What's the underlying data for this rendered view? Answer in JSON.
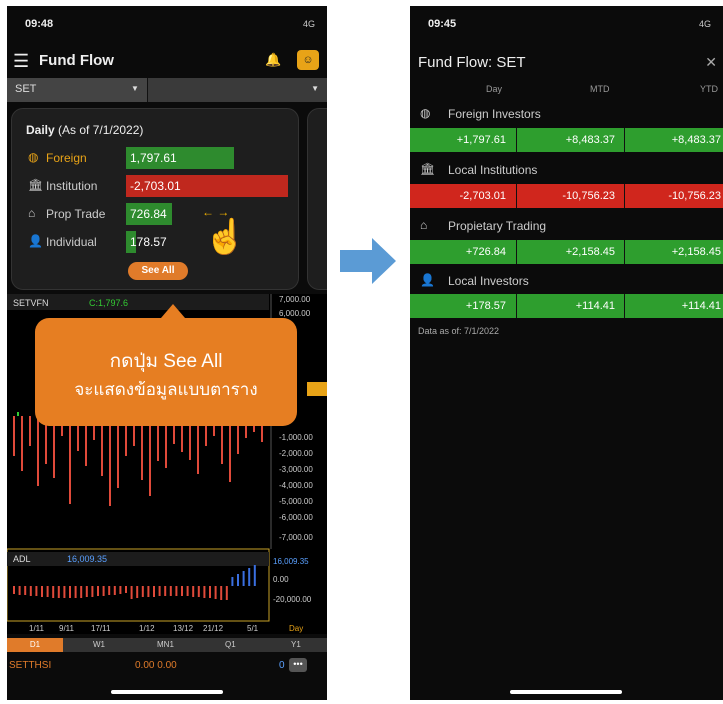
{
  "left": {
    "status": {
      "time": "09:48",
      "signal": "4G"
    },
    "header": {
      "title": "Fund Flow"
    },
    "selector": {
      "market": "SET"
    },
    "card": {
      "title_bold": "Daily",
      "title_rest": " (As of 7/1/2022)",
      "rows": [
        {
          "icon": "globe-icon",
          "label": "Foreign",
          "value": "1,797.61",
          "color": "#2e8b2e"
        },
        {
          "icon": "bank-icon",
          "label": "Institution",
          "value": "-2,703.01",
          "color": "#c0281e"
        },
        {
          "icon": "home-icon",
          "label": "Prop Trade",
          "value": "726.84",
          "color": "#2e8b2e"
        },
        {
          "icon": "person-icon",
          "label": "Individual",
          "value": "178.57",
          "color": "#2e8b2e"
        }
      ],
      "see_all": "See All"
    },
    "callout": {
      "line1": "กดปุ่ม See All",
      "line2": "จะแสดงข้อมูลแบบตาราง"
    },
    "chart": {
      "label": "SETVFN",
      "clabel": "C:1,797.6",
      "y_ticks": [
        "7,000.00",
        "6,000.00",
        "-1,000.00",
        "-2,000.00",
        "-3,000.00",
        "-4,000.00",
        "-5,000.00",
        "-6,000.00",
        "-7,000.00"
      ],
      "adl_label": "ADL",
      "adl_value": "16,009.35",
      "adl_ticks": [
        "16,009.35",
        "0.00",
        "-20,000.00"
      ],
      "x_ticks": [
        "1/11",
        "9/11",
        "17/11",
        "1/12",
        "13/12",
        "21/12",
        "5/1",
        "Day"
      ]
    },
    "periods": [
      "D1",
      "W1",
      "MN1",
      "Q1",
      "Y1"
    ],
    "footer": {
      "symbol": "SETTHSI",
      "values": "0.00 0.00",
      "count": "0"
    }
  },
  "right": {
    "status": {
      "time": "09:45",
      "signal": "4G"
    },
    "title": "Fund Flow: SET",
    "columns": [
      "Day",
      "MTD",
      "YTD"
    ],
    "sections": [
      {
        "icon": "globe-icon",
        "label": "Foreign Investors",
        "values": [
          "+1,797.61",
          "+8,483.37",
          "+8,483.37"
        ],
        "color": "#2e9e2e"
      },
      {
        "icon": "bank-icon",
        "label": "Local Institutions",
        "values": [
          "-2,703.01",
          "-10,756.23",
          "-10,756.23"
        ],
        "color": "#d0261d"
      },
      {
        "icon": "home-icon",
        "label": "Propietary Trading",
        "values": [
          "+726.84",
          "+2,158.45",
          "+2,158.45"
        ],
        "color": "#2e9e2e"
      },
      {
        "icon": "person-icon",
        "label": "Local Investors",
        "values": [
          "+178.57",
          "+114.41",
          "+114.41"
        ],
        "color": "#2e9e2e"
      }
    ],
    "data_as_of": "Data as of: 7/1/2022"
  }
}
